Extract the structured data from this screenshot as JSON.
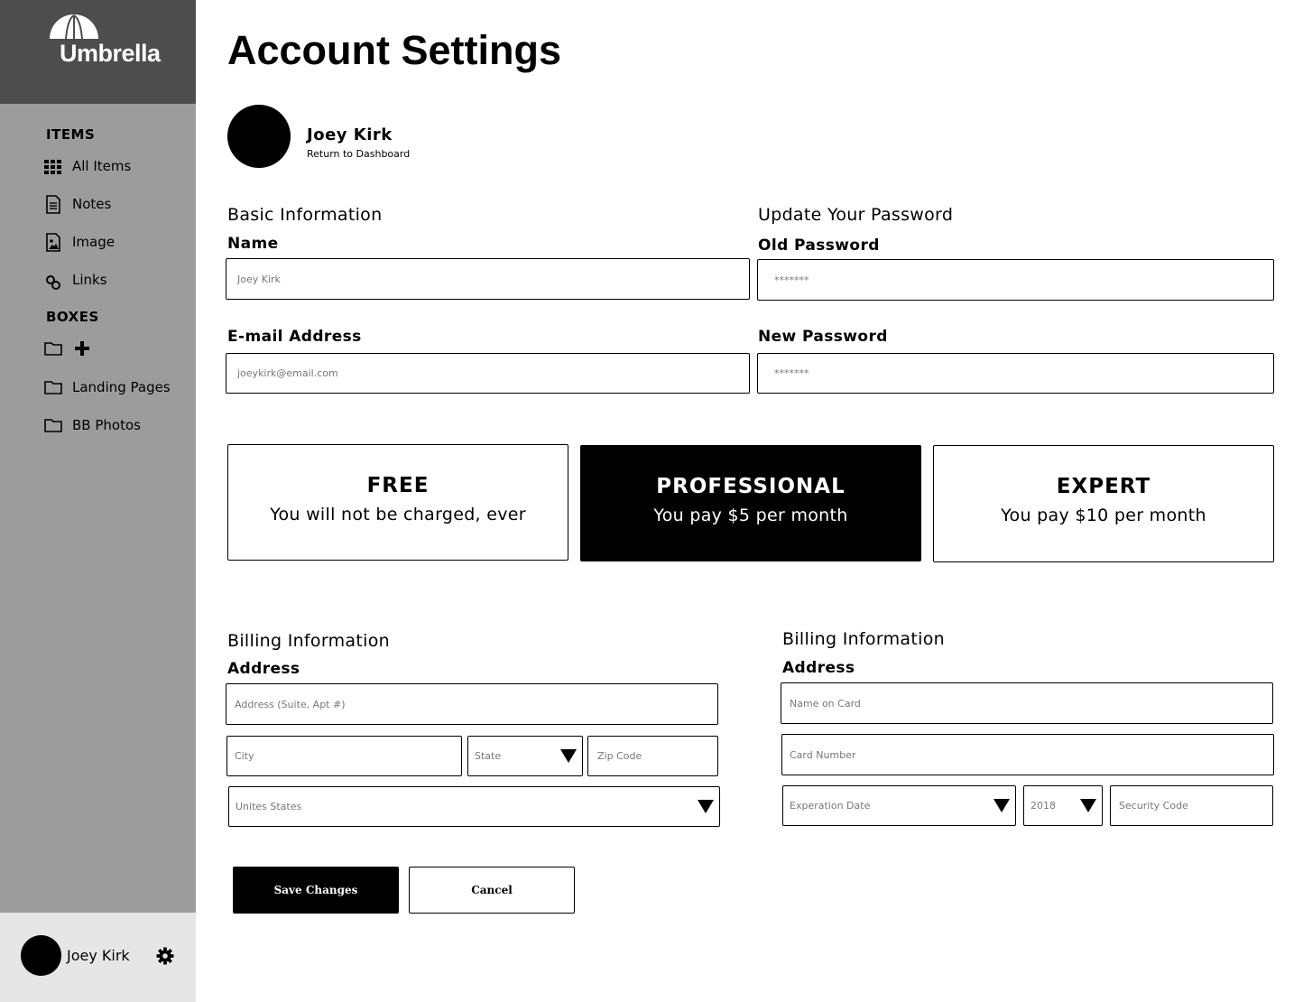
{
  "brand": {
    "name": "Umbrella"
  },
  "sidebar": {
    "items_heading": "ITEMS",
    "items": [
      {
        "label": "All Items",
        "icon": "grid-icon"
      },
      {
        "label": "Notes",
        "icon": "document-icon"
      },
      {
        "label": "Image",
        "icon": "image-icon"
      },
      {
        "label": "Links",
        "icon": "link-icon"
      }
    ],
    "boxes_heading": "BOXES",
    "boxes": [
      {
        "label": "Landing Pages",
        "icon": "folder-icon"
      },
      {
        "label": "BB Photos",
        "icon": "folder-icon"
      }
    ],
    "user": {
      "name": "Joey Kirk"
    }
  },
  "page": {
    "title": "Account Settings",
    "profile": {
      "name": "Joey Kirk",
      "link": "Return to Dashboard"
    }
  },
  "basic_info": {
    "title": "Basic Information",
    "name_label": "Name",
    "name_value": "Joey Kirk",
    "email_label": "E-mail Address",
    "email_value": "joeykirk@email.com"
  },
  "password": {
    "title": "Update Your Password",
    "old_label": "Old Password",
    "old_value": "*******",
    "new_label": "New Password",
    "new_value": "*******"
  },
  "plans": [
    {
      "name": "FREE",
      "desc": "You will not be charged, ever",
      "selected": false
    },
    {
      "name": "PROFESSIONAL",
      "desc": "You pay $5 per month",
      "selected": true
    },
    {
      "name": "EXPERT",
      "desc": "You pay $10 per month",
      "selected": false
    }
  ],
  "billing_left": {
    "title": "Billing Information",
    "label": "Address",
    "address_placeholder": "Address (Suite, Apt #)",
    "city_placeholder": "City",
    "state_placeholder": "State",
    "zip_placeholder": "Zip Code",
    "country_value": "Unites States"
  },
  "billing_right": {
    "title": "Billing Information",
    "label": "Address",
    "name_on_card_placeholder": "Name on Card",
    "card_number_placeholder": "Card Number",
    "expiration_placeholder": "Experation Date",
    "year_value": "2018",
    "security_placeholder": "Security Code"
  },
  "actions": {
    "save_label": "Save Changes",
    "cancel_label": "Cancel"
  },
  "colors": {
    "sidebar": "#9c9c9c",
    "logo_bg": "#4d4d4d",
    "footer_bg": "#e6e6e6",
    "accent": "#000000"
  }
}
